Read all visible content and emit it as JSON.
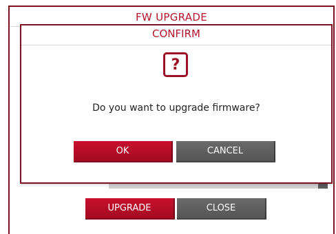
{
  "background_window": {
    "title": "FW UPGRADE",
    "progress": 0.0,
    "buttons": {
      "upgrade_label": "UPGRADE",
      "close_label": "CLOSE"
    }
  },
  "dialog": {
    "title": "CONFIRM",
    "icon": "question-icon",
    "icon_glyph": "?",
    "message": "Do you want to upgrade firmware?",
    "buttons": {
      "ok_label": "OK",
      "cancel_label": "CANCEL"
    }
  },
  "colors": {
    "accent_red": "#b5122b",
    "frame_dark_red": "#7a1020",
    "button_red": "#c8102e",
    "button_grey": "#5f5f5f"
  }
}
